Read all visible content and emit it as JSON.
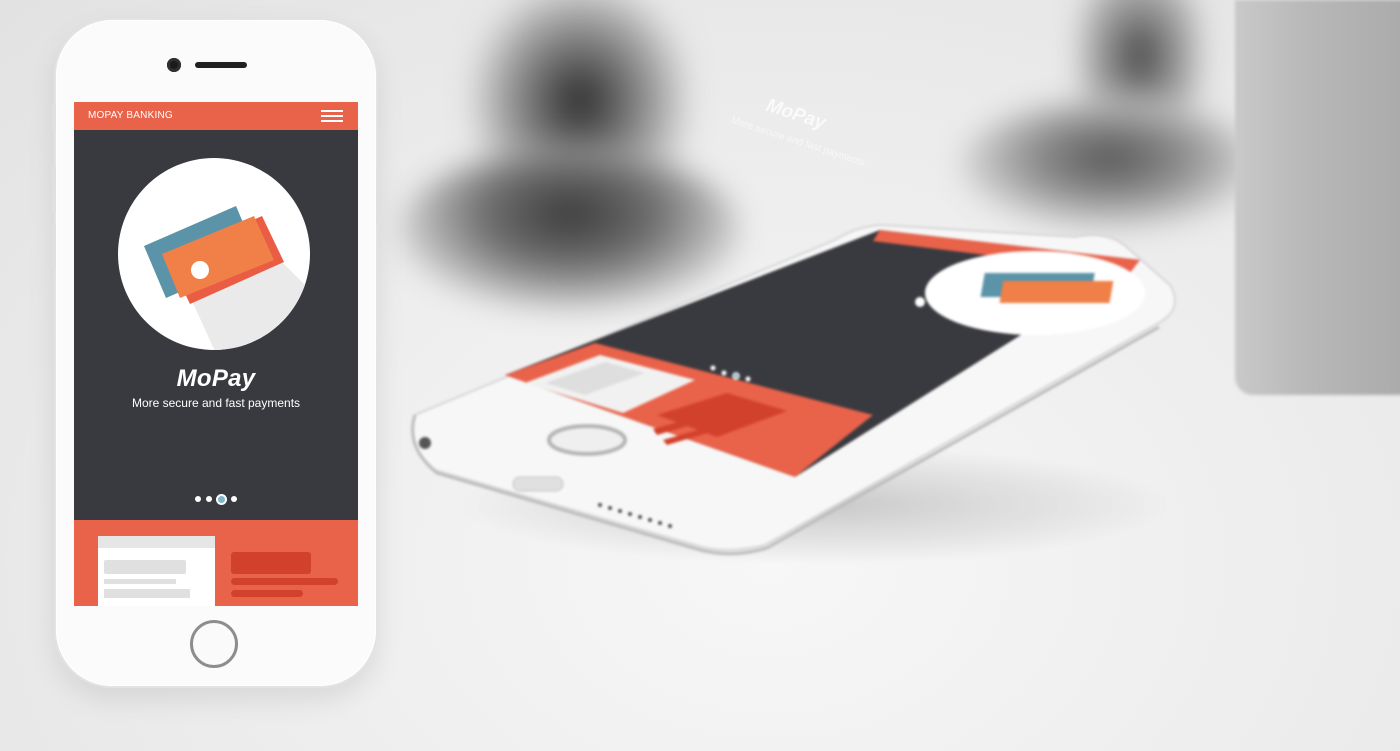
{
  "app": {
    "topbar_title": "MOPAY BANKING",
    "menu_icon": "hamburger-menu-icon"
  },
  "hero": {
    "illustration_icon": "credit-cards-icon",
    "brand": "MoPay",
    "tagline": "More secure and fast payments"
  },
  "pager": {
    "count": 4,
    "active_index": 2
  },
  "background_phone": {
    "brand": "MoPay",
    "tagline": "More secure and fast payments"
  },
  "colors": {
    "accent": "#e9624a",
    "accent_dark": "#d2412b",
    "screen_bg": "#393a3f",
    "card_teal": "#5b93a8",
    "card_orange": "#f08047",
    "card_red": "#ea5c44",
    "pager_active": "#7fb7c9"
  }
}
